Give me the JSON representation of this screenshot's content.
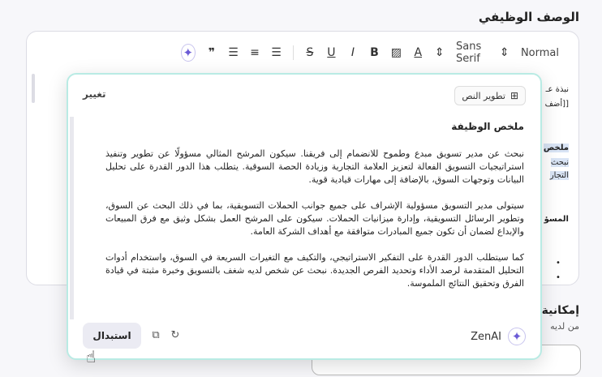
{
  "section_title": "الوصف الوظيفي",
  "toolbar": {
    "size_label": "Normal",
    "font_label": "Sans Serif",
    "items": [
      "size-dropdown",
      "font-dropdown",
      "text-color",
      "highlight",
      "bold",
      "italic",
      "underline",
      "strikethrough",
      "bullet-list",
      "ordered-list",
      "align",
      "quote",
      "ai"
    ]
  },
  "bg_editor": {
    "line1": "نبذة عـ",
    "line2": "[[أضف",
    "line3": "ملخص",
    "line4": "نبحث",
    "line5": "التجار",
    "line6": "المسؤ"
  },
  "below": {
    "title": "إمكانية",
    "subtitle": "من لديه"
  },
  "ai_popup": {
    "develop_text_label": "تطوير النص",
    "change_label": "تغيير",
    "heading": "ملخص الوظيفة",
    "para1": "نبحث عن مدير تسويق مبدع وطموح للانضمام إلى فريقنا. سيكون المرشح المثالي مسؤولًا عن تطوير وتنفيذ استراتيجيات التسويق الفعالة لتعزيز العلامة التجارية وزيادة الحصة السوقية. يتطلب هذا الدور القدرة على تحليل البيانات وتوجهات السوق، بالإضافة إلى مهارات قيادية قوية.",
    "para2": "سيتولى مدير التسويق مسؤولية الإشراف على جميع جوانب الحملات التسويقية، بما في ذلك البحث عن السوق، وتطوير الرسائل التسويقية، وإدارة ميزانيات الحملات. سيكون على المرشح العمل بشكل وثيق مع فرق المبيعات والإبداع لضمان أن تكون جميع المبادرات متوافقة مع أهداف الشركة العامة.",
    "para3": "كما سيتطلب الدور القدرة على التفكير الاستراتيجي، والتكيف مع التغيرات السريعة في السوق، واستخدام أدوات التحليل المتقدمة لرصد الأداء وتحديد الفرص الجديدة. نبحث عن شخص لديه شغف بالتسويق وخبرة مثبتة في قيادة الفرق وتحقيق النتائج الملموسة.",
    "brand": "ZenAI",
    "replace_label": "استبدال"
  },
  "colors": {
    "accent": "#6b5bd6",
    "popup_border": "#b9ebe4"
  }
}
